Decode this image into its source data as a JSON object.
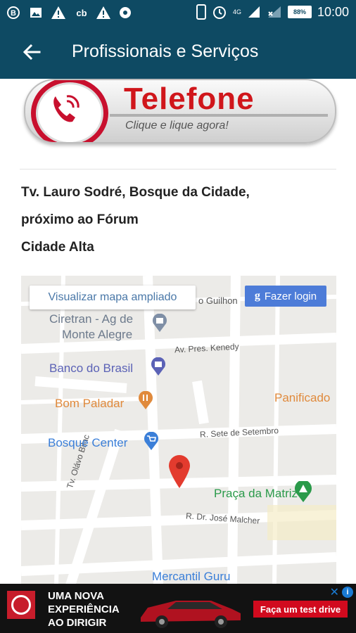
{
  "statusbar": {
    "time": "10:00",
    "battery": "88%",
    "network": "4G",
    "icons": [
      "b-icon",
      "image-icon",
      "warning-icon",
      "cb-icon",
      "warning-icon",
      "ai-icon",
      "phone-icon",
      "alarm-icon",
      "signal-icon",
      "signal-x-icon",
      "battery-icon"
    ]
  },
  "appbar": {
    "title": "Profissionais e Serviços"
  },
  "phone_banner": {
    "word": "Telefone",
    "subtitle": "Clique e lique agora!"
  },
  "address": {
    "line1": "Tv. Lauro Sodré, Bosque da Cidade,",
    "line2": "próximo ao Fórum",
    "line3": "Cidade Alta"
  },
  "map": {
    "view_larger": "Visualizar mapa ampliado",
    "login": "Fazer login",
    "places": {
      "ciretran_1": "Ciretran - Ag de",
      "ciretran_2": "Monte Alegre",
      "banco": "Banco do Brasil",
      "bom_paladar": "Bom Paladar",
      "panificadora": "Panificado",
      "bosque_center": "Bosque Center",
      "praca": "Praça da Matriz",
      "mercantil": "Mercantil Guru"
    },
    "streets": {
      "guilhon": "o Guilhon",
      "kenedy": "Av. Pres. Kenedy",
      "sete": "R. Sete de Setembro",
      "bilac": "Tv. Olávo Bilac",
      "malcher": "R. Dr. José Malcher"
    },
    "colors": {
      "gov": "#7f8fa6",
      "bank": "#5b62b6",
      "food": "#e08a3c",
      "shop": "#3b7fd8",
      "park": "#2a9a4a",
      "pin": "#e33b2e"
    }
  },
  "ad": {
    "line1": "UMA NOVA",
    "line2": "EXPERIÊNCIA",
    "line3": "AO DIRIGIR",
    "cta": "Faça um test drive"
  }
}
